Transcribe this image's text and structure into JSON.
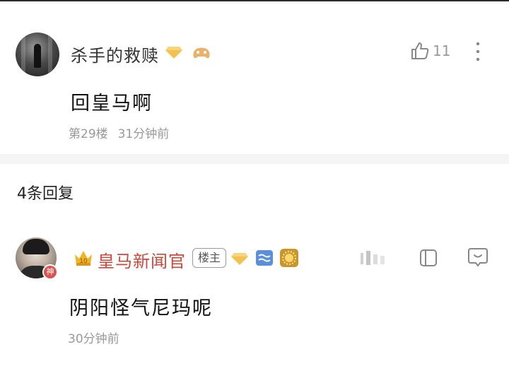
{
  "comment": {
    "username": "杀手的救赎",
    "like_count": "11",
    "text": "回皇马啊",
    "floor": "第29楼",
    "time": "31分钟前"
  },
  "replies_header": "4条回复",
  "reply": {
    "username": "皇马新闻官",
    "op_tag": "楼主",
    "god_badge": "神",
    "text": "阴阳怪气尼玛呢",
    "time": "30分钟前"
  },
  "icons": {
    "diamond": "diamond-badge-icon",
    "game": "gamepad-badge-icon",
    "like": "thumbs-up-icon",
    "more": "more-vertical-icon",
    "crown": "crown-badge-icon",
    "copy": "copy-icon",
    "chat": "chat-bubble-icon"
  },
  "colors": {
    "reply_username": "#c94a3b",
    "diamond": "#f2c14e",
    "muted_text": "#999999"
  }
}
